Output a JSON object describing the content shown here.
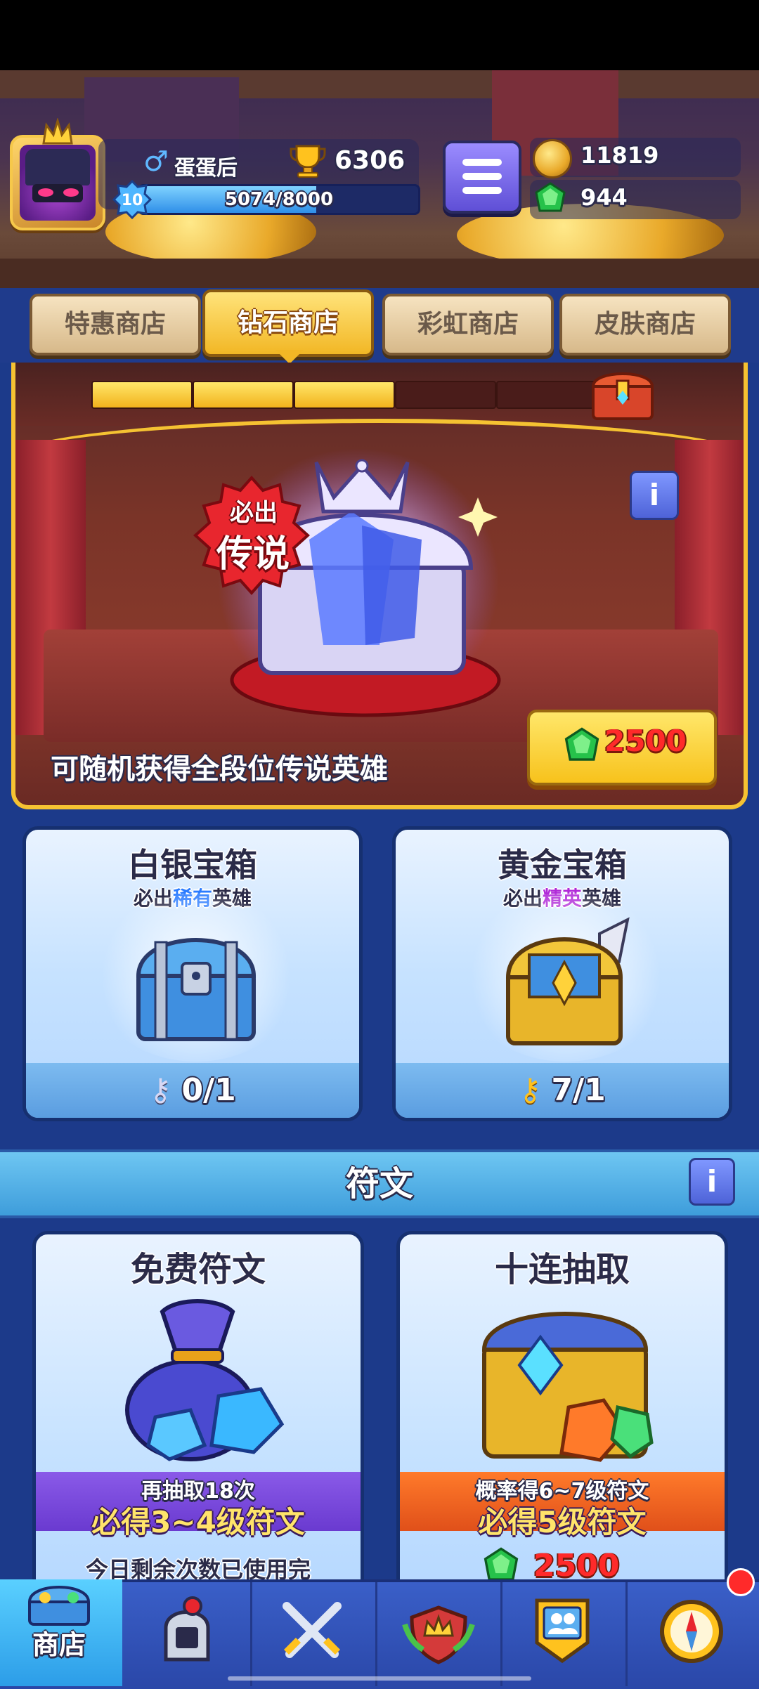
{
  "player": {
    "name": "蛋蛋后",
    "level": "10",
    "xp_text": "5074/8000",
    "xp_fraction": 0.634,
    "trophies": "6306"
  },
  "resources": {
    "gold": "11819",
    "gems": "944"
  },
  "tabs": [
    {
      "label": "特惠商店",
      "active": false
    },
    {
      "label": "钻石商店",
      "active": true
    },
    {
      "label": "彩虹商店",
      "active": false
    },
    {
      "label": "皮肤商店",
      "active": false
    }
  ],
  "banner": {
    "badge_line1": "必出",
    "badge_line2": "传说",
    "description": "可随机获得全段位传说英雄",
    "price": "2500",
    "progress_filled_segments": 3,
    "progress_total_segments": 5
  },
  "chests": [
    {
      "title": "白银宝箱",
      "sub_prefix": "必出",
      "sub_rarity": "稀有",
      "sub_suffix": "英雄",
      "rarity_color": "#2a7bff",
      "keys": "0/1"
    },
    {
      "title": "黄金宝箱",
      "sub_prefix": "必出",
      "sub_rarity": "精英",
      "sub_suffix": "英雄",
      "rarity_color": "#b02ad8",
      "keys": "7/1"
    }
  ],
  "runes": {
    "section_title": "符文",
    "free": {
      "title": "免费符文",
      "band_line1": "再抽取18次",
      "band_line2": "必得3~4级符文",
      "footer": "今日剩余次数已使用完"
    },
    "ten": {
      "title": "十连抽取",
      "band_line1": "概率得6~7级符文",
      "band_line2": "必得5级符文",
      "price": "2500"
    }
  },
  "bottom_nav": {
    "shop_label": "商店"
  },
  "colors": {
    "accent_gold": "#f5c232",
    "gem_green": "#26c24a",
    "price_red": "#ff2a2a"
  }
}
